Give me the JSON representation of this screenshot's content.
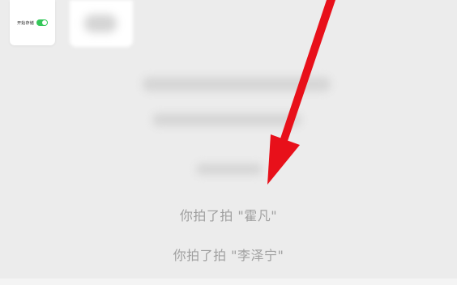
{
  "toggle_card": {
    "label": "开始存储",
    "state": "on",
    "color_on": "#34c759"
  },
  "messages": {
    "pat_1": "你拍了拍 \"霍凡\"",
    "pat_2": "你拍了拍 \"李泽宁\""
  },
  "annotation": {
    "icon": "red-arrow-icon",
    "color": "#e8101a"
  }
}
